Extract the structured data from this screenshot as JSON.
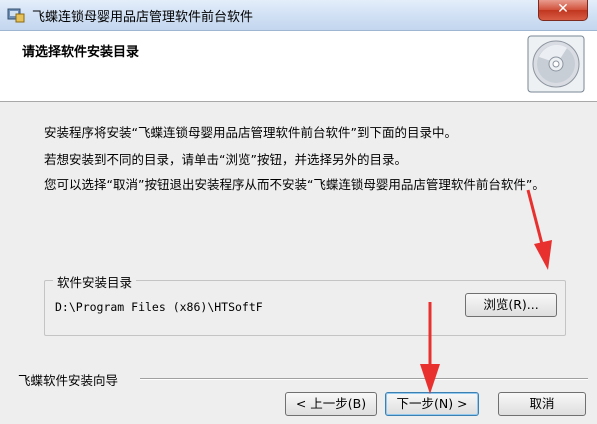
{
  "window": {
    "title": "飞蝶连锁母婴用品店管理软件前台软件",
    "close_label": "✕"
  },
  "header": {
    "title": "请选择软件安装目录",
    "icon": "cd-disc-icon"
  },
  "body": {
    "line1": "安装程序将安装“飞蝶连锁母婴用品店管理软件前台软件”到下面的目录中。",
    "line2": "若想安装到不同的目录，请单击“浏览”按钮，并选择另外的目录。",
    "line3": "您可以选择“取消”按钮退出安装程序从而不安装“飞蝶连锁母婴用品店管理软件前台软件”。"
  },
  "install_dir": {
    "group_label": "软件安装目录",
    "path": "D:\\Program Files (x86)\\HTSoftF",
    "browse_label": "浏览(R)..."
  },
  "footer": {
    "wizard_label": "飞蝶软件安装向导",
    "back_label": "< 上一步(B)",
    "next_label": "下一步(N) >",
    "cancel_label": "取消"
  },
  "colors": {
    "annotation_arrow": "#e8312f",
    "titlebar": "#d3e2f5",
    "close_button": "#c1361f"
  }
}
